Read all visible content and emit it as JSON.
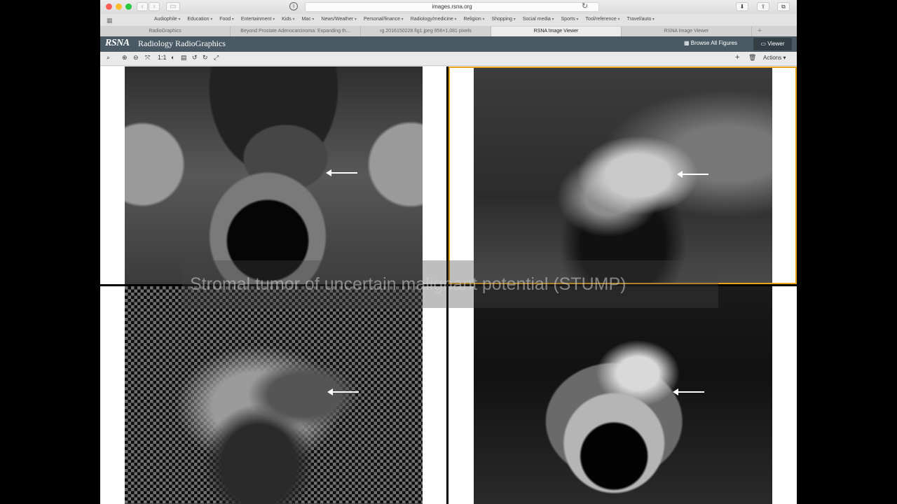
{
  "browser": {
    "address": "images.rsna.org",
    "bookmarks": [
      "Audiophile",
      "Education",
      "Food",
      "Entertainment",
      "Kids",
      "Mac",
      "News/Weather",
      "Personal/finance",
      "Radiology/medicine",
      "Religion",
      "Shopping",
      "Social media",
      "Sports",
      "Tool/reference",
      "Travel/auto"
    ],
    "tabs": [
      {
        "label": "RadioGraphics",
        "active": false
      },
      {
        "label": "Beyond Prostate Adenocarcinoma: Expanding th...",
        "active": false
      },
      {
        "label": "rg.2016150228.fig1.jpeg 956×1,081 pixels",
        "active": false
      },
      {
        "label": "RSNA Image Viewer",
        "active": true
      },
      {
        "label": "RSNA Image Viewer",
        "active": false
      }
    ]
  },
  "header": {
    "logo": "RSNA",
    "title": "Radiology RadioGraphics",
    "browse_label": "Browse All Figures",
    "viewer_label": "Viewer"
  },
  "toolbar": {
    "zoom_label": "1:1",
    "actions_label": "Actions"
  },
  "caption": "Stromal tumor of uncertain malignant potential (STUMP)",
  "colors": {
    "selected_panel_border": "#e8a219",
    "header_bg": "#4a5a64"
  }
}
